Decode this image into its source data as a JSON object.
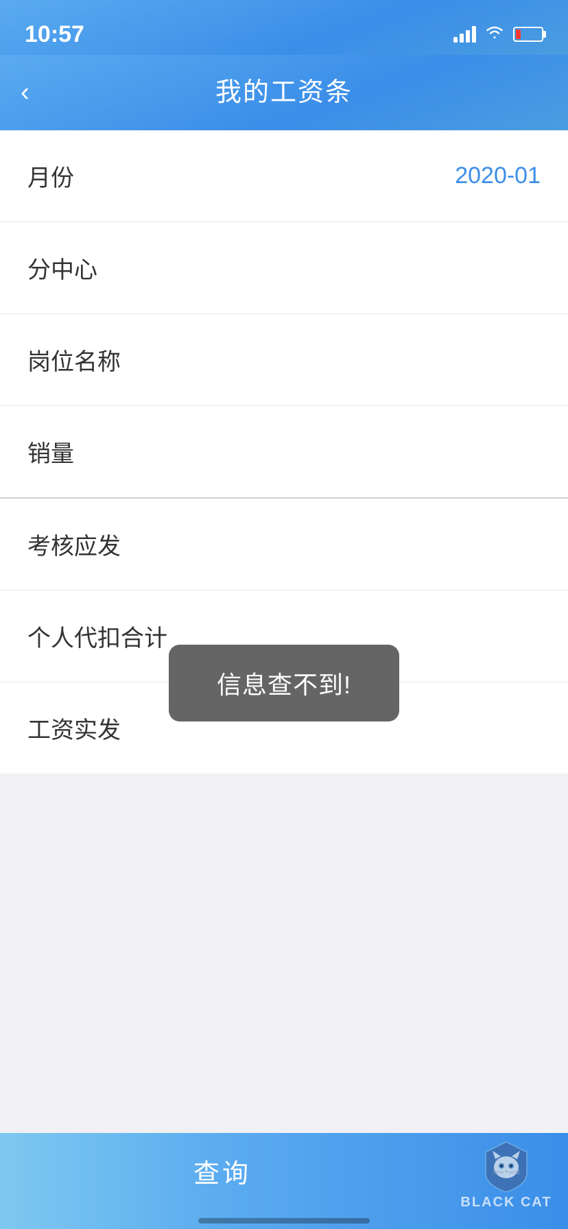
{
  "statusBar": {
    "time": "10:57"
  },
  "navBar": {
    "title": "我的工资条",
    "backLabel": "‹"
  },
  "rows": [
    {
      "label": "月份",
      "value": "2020-01",
      "hasValue": true
    },
    {
      "label": "分中心",
      "value": "",
      "hasValue": false
    },
    {
      "label": "岗位名称",
      "value": "",
      "hasValue": false
    },
    {
      "label": "销量",
      "value": "",
      "hasValue": false
    },
    {
      "label": "考核应发",
      "value": "",
      "hasValue": false
    },
    {
      "label": "个人代扣合计",
      "value": "",
      "hasValue": false
    },
    {
      "label": "工资实发",
      "value": "",
      "hasValue": false
    }
  ],
  "toast": {
    "message": "信息查不到!"
  },
  "bottomBar": {
    "queryLabel": "查询",
    "catText": "BLACK CAT"
  }
}
